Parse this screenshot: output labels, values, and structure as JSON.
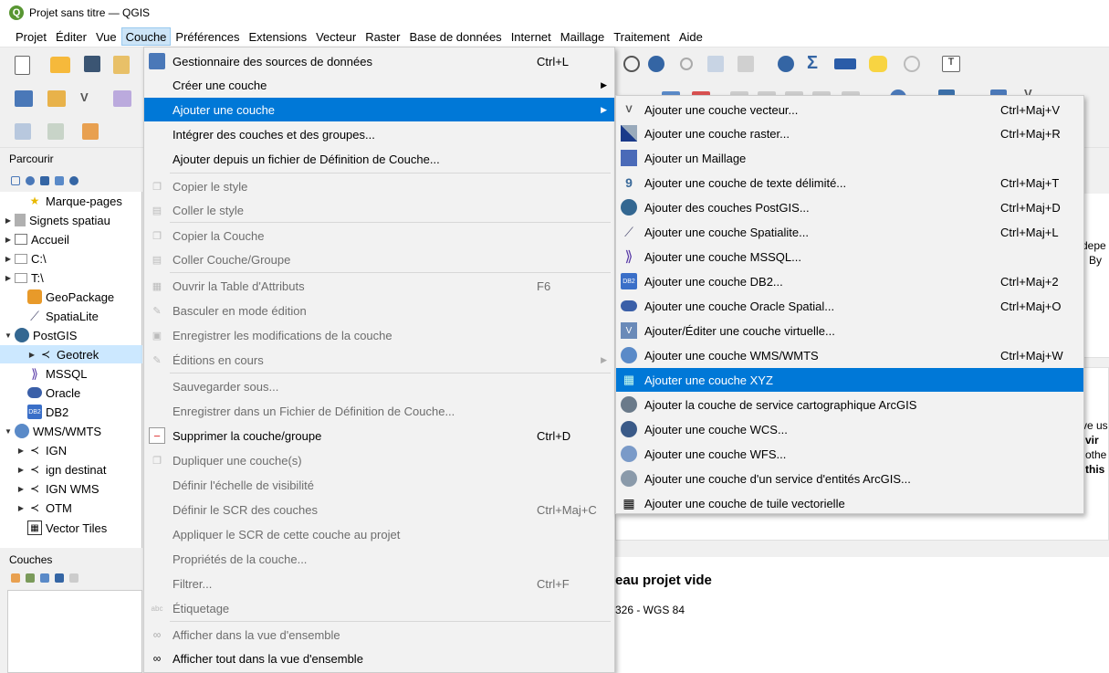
{
  "window": {
    "title": "Projet sans titre — QGIS",
    "logo_letter": "Q"
  },
  "menubar": {
    "items": [
      "Projet",
      "Éditer",
      "Vue",
      "Couche",
      "Préférences",
      "Extensions",
      "Vecteur",
      "Raster",
      "Base de données",
      "Internet",
      "Maillage",
      "Traitement",
      "Aide"
    ],
    "active": "Couche"
  },
  "browser": {
    "title": "Parcourir",
    "items": [
      {
        "label": "Marque-pages",
        "icon": "star-icon"
      },
      {
        "label": "Signets spatiau",
        "icon": "bookmark-icon"
      },
      {
        "label": "Accueil",
        "icon": "home-folder-icon"
      },
      {
        "label": "C:\\",
        "icon": "drive-icon"
      },
      {
        "label": "T:\\",
        "icon": "drive-icon"
      },
      {
        "label": "GeoPackage",
        "icon": "geopackage-icon"
      },
      {
        "label": "SpatiaLite",
        "icon": "spatialite-icon"
      },
      {
        "label": "PostGIS",
        "icon": "postgis-icon"
      },
      {
        "label": "Geotrek",
        "icon": "connection-icon"
      },
      {
        "label": "MSSQL",
        "icon": "mssql-icon"
      },
      {
        "label": "Oracle",
        "icon": "oracle-icon"
      },
      {
        "label": "DB2",
        "icon": "db2-icon"
      },
      {
        "label": "WMS/WMTS",
        "icon": "globe-icon"
      },
      {
        "label": "IGN",
        "icon": "connection-icon"
      },
      {
        "label": "ign destinat",
        "icon": "connection-icon"
      },
      {
        "label": "IGN WMS",
        "icon": "connection-icon"
      },
      {
        "label": "OTM",
        "icon": "connection-icon"
      },
      {
        "label": "Vector Tiles",
        "icon": "vector-tiles-icon"
      }
    ]
  },
  "couches_panel": {
    "title": "Couches"
  },
  "background": {
    "new_project": "eau projet vide",
    "crs": "326 - WGS 84",
    "fragments": [
      "depe",
      "By",
      "ve us",
      "vir",
      "othe",
      "this"
    ]
  },
  "couche_menu": {
    "items": [
      {
        "label": "Gestionnaire des sources de données",
        "shortcut": "Ctrl+L",
        "icon": "datasource-manager-icon"
      },
      {
        "label": "Créer une couche",
        "submenu": true
      },
      {
        "label": "Ajouter une couche",
        "submenu": true,
        "highlighted": true
      },
      {
        "label": "Intégrer des couches et des groupes..."
      },
      {
        "label": "Ajouter depuis un fichier de Définition de Couche..."
      },
      {
        "label": "Copier le style",
        "disabled": true,
        "icon": "copy-style-icon"
      },
      {
        "label": "Coller le style",
        "disabled": true,
        "icon": "paste-style-icon"
      },
      {
        "label": "Copier la Couche",
        "disabled": true,
        "icon": "copy-layer-icon"
      },
      {
        "label": "Coller Couche/Groupe",
        "disabled": true,
        "icon": "paste-layer-icon"
      },
      {
        "label": "Ouvrir la Table d'Attributs",
        "shortcut": "F6",
        "disabled": true,
        "icon": "attribute-table-icon"
      },
      {
        "label": "Basculer en mode édition",
        "disabled": true,
        "icon": "pencil-icon"
      },
      {
        "label": "Enregistrer les modifications de la couche",
        "disabled": true,
        "icon": "save-edits-icon"
      },
      {
        "label": "Éditions en cours",
        "disabled": true,
        "submenu": true,
        "icon": "pencils-icon"
      },
      {
        "label": "Sauvegarder sous...",
        "disabled": true
      },
      {
        "label": "Enregistrer dans un Fichier de Définition de Couche...",
        "disabled": true
      },
      {
        "label": "Supprimer la couche/groupe",
        "shortcut": "Ctrl+D",
        "icon": "remove-layer-icon"
      },
      {
        "label": "Dupliquer une couche(s)",
        "disabled": true,
        "icon": "duplicate-layer-icon"
      },
      {
        "label": "Définir l'échelle de visibilité",
        "disabled": true
      },
      {
        "label": "Définir le SCR des couches",
        "shortcut": "Ctrl+Maj+C",
        "disabled": true
      },
      {
        "label": "Appliquer le SCR de cette couche au projet",
        "disabled": true
      },
      {
        "label": "Propriétés de la couche...",
        "disabled": true
      },
      {
        "label": "Filtrer...",
        "shortcut": "Ctrl+F",
        "disabled": true
      },
      {
        "label": "Étiquetage",
        "disabled": true,
        "icon": "labeling-icon"
      },
      {
        "label": "Afficher dans la vue d'ensemble",
        "disabled": true,
        "icon": "overview-icon"
      },
      {
        "label": "Afficher tout dans la vue d'ensemble",
        "icon": "overview-all-icon"
      }
    ]
  },
  "add_layer_submenu": {
    "items": [
      {
        "label": "Ajouter une couche vecteur...",
        "shortcut": "Ctrl+Maj+V",
        "icon": "add-vector-icon"
      },
      {
        "label": "Ajouter une couche raster...",
        "shortcut": "Ctrl+Maj+R",
        "icon": "add-raster-icon"
      },
      {
        "label": "Ajouter un Maillage",
        "icon": "add-mesh-icon"
      },
      {
        "label": "Ajouter une couche de texte délimité...",
        "shortcut": "Ctrl+Maj+T",
        "icon": "add-delimited-text-icon"
      },
      {
        "label": "Ajouter des couches PostGIS...",
        "shortcut": "Ctrl+Maj+D",
        "icon": "add-postgis-icon"
      },
      {
        "label": "Ajouter une couche Spatialite...",
        "shortcut": "Ctrl+Maj+L",
        "icon": "add-spatialite-icon"
      },
      {
        "label": "Ajouter une couche MSSQL...",
        "icon": "add-mssql-icon"
      },
      {
        "label": "Ajouter une couche DB2...",
        "shortcut": "Ctrl+Maj+2",
        "icon": "add-db2-icon"
      },
      {
        "label": "Ajouter une couche Oracle Spatial...",
        "shortcut": "Ctrl+Maj+O",
        "icon": "add-oracle-icon"
      },
      {
        "label": "Ajouter/Éditer une couche virtuelle...",
        "icon": "add-virtual-icon"
      },
      {
        "label": "Ajouter une couche WMS/WMTS",
        "shortcut": "Ctrl+Maj+W",
        "icon": "add-wms-icon"
      },
      {
        "label": "Ajouter une couche XYZ",
        "highlighted": true,
        "icon": "add-xyz-icon"
      },
      {
        "label": "Ajouter la couche de service cartographique ArcGIS",
        "icon": "add-arcgis-map-icon"
      },
      {
        "label": "Ajouter une couche WCS...",
        "icon": "add-wcs-icon"
      },
      {
        "label": "Ajouter une couche WFS...",
        "icon": "add-wfs-icon"
      },
      {
        "label": "Ajouter une couche d'un service d'entités ArcGIS...",
        "icon": "add-arcgis-feature-icon"
      },
      {
        "label": "Ajouter une couche de tuile vectorielle",
        "icon": "add-vector-tile-icon"
      }
    ]
  },
  "colors": {
    "highlight": "#0078d7",
    "menu_bg": "#f2f2f2",
    "qgis_green": "#589632"
  }
}
